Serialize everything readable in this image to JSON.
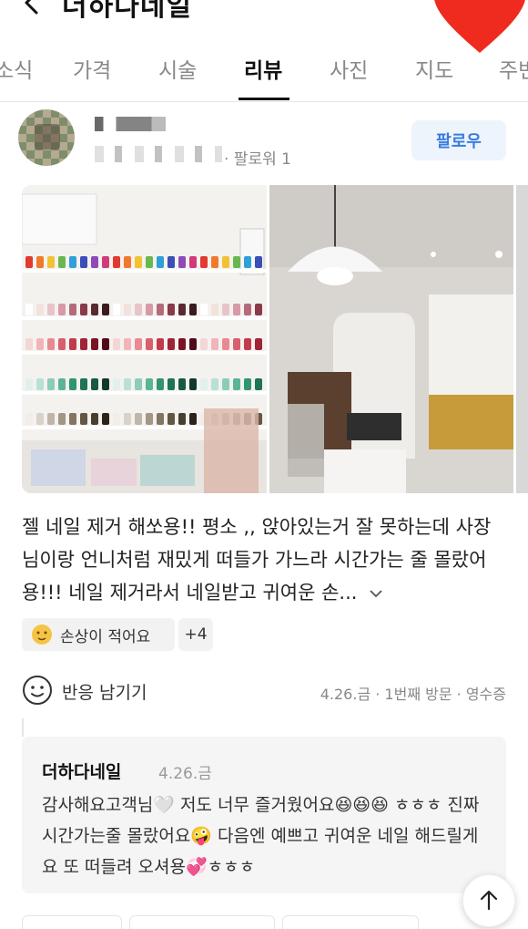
{
  "header": {
    "title": "더하다네일"
  },
  "tabs": [
    {
      "label": "소식"
    },
    {
      "label": "가격"
    },
    {
      "label": "시술"
    },
    {
      "label": "리뷰"
    },
    {
      "label": "사진"
    },
    {
      "label": "지도"
    },
    {
      "label": "주변"
    }
  ],
  "review": {
    "follower_text": "· 팔로워 1",
    "follow_label": "팔로우",
    "text": "젤 네일 제거 해쏘용!! 평소 ,, 앉아있는거 잘 못하는데 사장님이랑 언니처럼 재밌게 떠들가 가느라 시간가는 줄 몰랐어용!!! 네일 제거라서 네일받고 귀여운 손...",
    "keyword_chip": "손상이 적어요",
    "more_keywords": "+4",
    "reaction_label": "반응 남기기",
    "visit_info": "4.26.금 · 1번째 방문 · 영수증"
  },
  "reply": {
    "owner": "더하다네일",
    "date": "4.26.금",
    "text": "감사해요고객님🤍 저도 너무 즐거웠어요😆😆😆 ㅎㅎㅎ 진짜 시간가는줄 몰랐어요🤪 다음엔 예쁘고 귀여운 네일 해드릴게요 또 떠들려 오셔용💞ㅎㅎㅎ"
  },
  "colors": {
    "accent": "#3a7be0",
    "heart": "#ef2b1f"
  },
  "icons": [
    "back-icon",
    "heart-icon",
    "chevron-down-icon",
    "emoji-icon",
    "smile-icon",
    "arrow-up-icon"
  ]
}
